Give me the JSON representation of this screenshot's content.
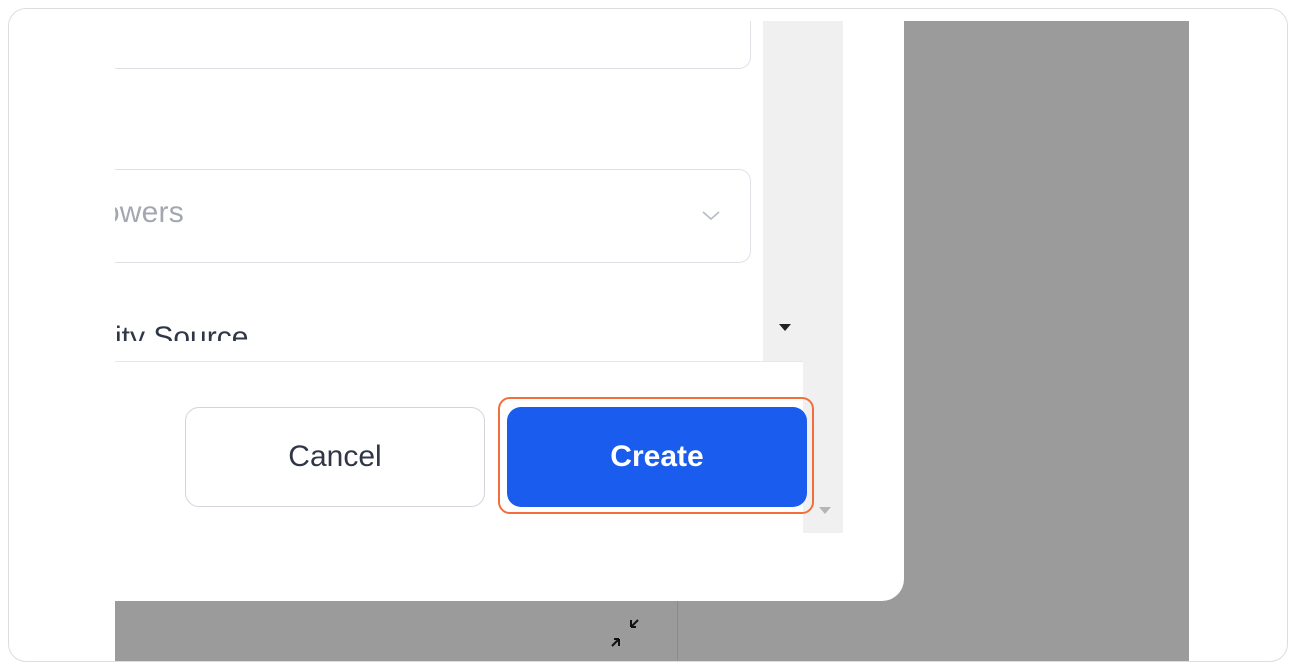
{
  "form": {
    "select_value": "lowers",
    "field_label": "ity Source"
  },
  "footer": {
    "cancel_label": "Cancel",
    "create_label": "Create"
  },
  "icons": {
    "dropdown": "chevron-down-icon",
    "collapse": "collapse-arrows-icon",
    "scroll_down": "triangle-down-icon"
  },
  "colors": {
    "primary": "#1a5ced",
    "focus_ring": "#f26f3d",
    "backdrop": "#9b9b9b"
  }
}
